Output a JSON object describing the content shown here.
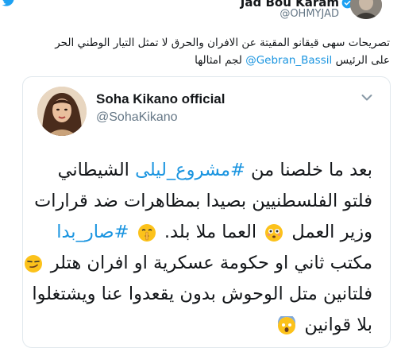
{
  "outer_tweet": {
    "name": "Jad Bou Karam",
    "handle": "@OHMYJAD",
    "text_line1": "تصريحات سهى قيقانو المقيتة عن الافران والحرق لا تمثل التيار الوطني الحر",
    "text_line2_prefix": "على الرئيس",
    "mention": "@Gebran_Bassil",
    "text_line2_suffix": "لجم امثالها"
  },
  "quoted_tweet": {
    "name": "Soha Kikano official",
    "handle": "@SohaKikano",
    "line1_a": "بعد ما خلصنا من ",
    "line1_hashtag": "#مشروع_ليلى",
    "line1_b": " الشيطاني",
    "line2": "فلتو الفلسطنيين بصيدا بمظاهرات ضد  قرارات",
    "line3_a": "وزير العمل ",
    "line3_b": " العما ملا بلد. ",
    "line3_hashtag": "#صار_بدا",
    "line4": "مكتب ثاني او حكومة عسكرية او افران هتلر",
    "line5": "فلتانين متل الوحوش بدون يقعدوا عنا ويشتغلوا",
    "line6": "بلا قوانين"
  },
  "icons": {
    "twitter": "twitter-bird-icon",
    "verified": "verified-badge-icon",
    "chevron": "chevron-down-icon",
    "emoji_1": "flushed-face-emoji",
    "emoji_2": "shushing-face-emoji",
    "emoji_3": "smirking-face-emoji",
    "emoji_4": "screaming-face-emoji"
  },
  "colors": {
    "link": "#1b95e0",
    "text": "#14171a",
    "secondary": "#657786",
    "border": "#e1e8ed"
  }
}
